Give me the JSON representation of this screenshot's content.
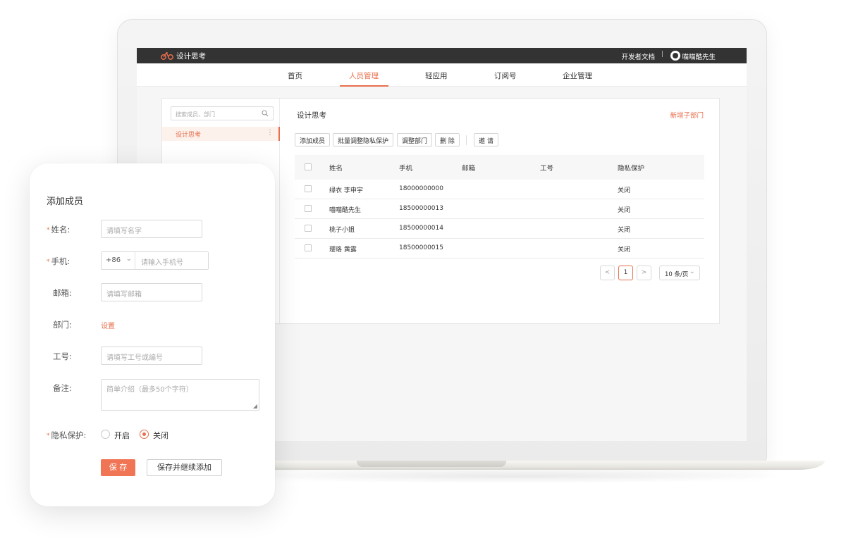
{
  "brand": {
    "name": "设计思考",
    "accent": "#e86f4d",
    "logo_icon": "bicycle-icon"
  },
  "topbar": {
    "dev_docs": "开发者文档",
    "separator": "|",
    "user_name": "喵喵酷先生",
    "user_icon": "avatar-icon"
  },
  "nav": {
    "items": [
      {
        "label": "首页",
        "active": false
      },
      {
        "label": "人员管理",
        "active": true
      },
      {
        "label": "轻应用",
        "active": false
      },
      {
        "label": "订阅号",
        "active": false
      },
      {
        "label": "企业管理",
        "active": false
      }
    ]
  },
  "sidebar": {
    "search_placeholder": "搜索成员、部门",
    "search_icon": "search-icon",
    "departments": [
      {
        "label": "设计思考",
        "more": "⋮"
      }
    ]
  },
  "main": {
    "title": "设计思考",
    "add_subdept": "新增子部门",
    "toolbar": {
      "add_member": "添加成员",
      "batch_privacy": "批量调整隐私保护",
      "adjust_dept": "调整部门",
      "delete": "删 除",
      "invite": "邀 请"
    },
    "table": {
      "headers": {
        "name": "姓名",
        "phone": "手机",
        "email": "邮箱",
        "id": "工号",
        "privacy": "隐私保护"
      },
      "rows": [
        {
          "name": "绿衣 李申宇",
          "phone": "18000000000",
          "email": "",
          "id": "",
          "privacy": "关闭"
        },
        {
          "name": "喵喵酷先生",
          "phone": "18500000013",
          "email": "",
          "id": "",
          "privacy": "关闭"
        },
        {
          "name": "桃子小姐",
          "phone": "18500000014",
          "email": "",
          "id": "",
          "privacy": "关闭"
        },
        {
          "name": "璎珞 黄露",
          "phone": "18500000015",
          "email": "",
          "id": "",
          "privacy": "关闭"
        }
      ]
    },
    "pagination": {
      "prev": "<",
      "current": "1",
      "next": ">",
      "page_size": "10 条/页",
      "page_size_chevron": "⌄"
    }
  },
  "form": {
    "title": "添加成员",
    "required_mark": "*",
    "name": {
      "label": "姓名:",
      "placeholder": "请填写名字"
    },
    "phone": {
      "label": "手机:",
      "code": "+86",
      "placeholder": "请输入手机号"
    },
    "email": {
      "label": "邮箱:",
      "placeholder": "请填写邮箱"
    },
    "dept": {
      "label": "部门:",
      "action": "设置"
    },
    "emp_id": {
      "label": "工号:",
      "placeholder": "请填写工号或编号"
    },
    "note": {
      "label": "备注:",
      "placeholder": "简单介绍（最多50个字符）"
    },
    "privacy": {
      "label": "隐私保护:",
      "on": "开启",
      "off": "关闭",
      "selected": "关闭"
    },
    "save": "保 存",
    "save_continue": "保存并继续添加"
  }
}
